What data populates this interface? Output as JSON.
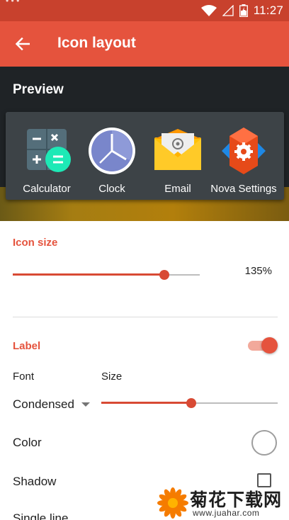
{
  "status_bar": {
    "time": "11:27",
    "left_icons": "• • •",
    "background_color": "#c8412d"
  },
  "toolbar": {
    "title": "Icon layout",
    "back_icon": "arrow-back-icon",
    "background_color": "#e5533d"
  },
  "preview": {
    "title": "Preview",
    "apps": [
      {
        "label": "Calculator",
        "icon": "calculator-icon"
      },
      {
        "label": "Clock",
        "icon": "clock-icon"
      },
      {
        "label": "Email",
        "icon": "email-icon"
      },
      {
        "label": "Nova Settings",
        "icon": "nova-settings-icon"
      }
    ]
  },
  "icon_size": {
    "section_label": "Icon size",
    "value_text": "135%",
    "slider_fraction": 0.81
  },
  "label": {
    "section_label": "Label",
    "enabled": true,
    "font_label": "Font",
    "size_label": "Size",
    "font_value": "Condensed",
    "size_slider_fraction": 0.51,
    "color_label": "Color",
    "color_value": "#ffffff",
    "shadow_label": "Shadow",
    "shadow_checked": false,
    "next_row_label": "Single line"
  },
  "watermark": {
    "text_cn": "菊花下载网",
    "url": "www.juahar.com"
  },
  "accent_color": "#e5533d"
}
